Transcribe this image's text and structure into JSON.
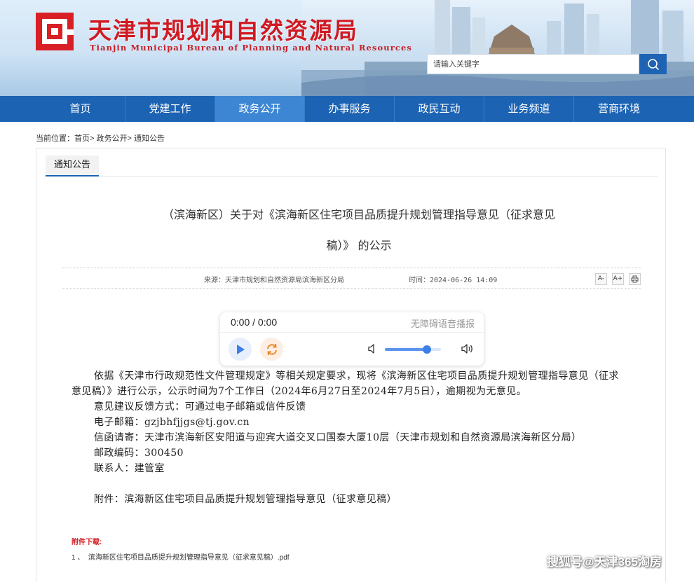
{
  "header": {
    "site_title": "天津市规划和自然资源局",
    "site_subtitle": "Tianjin Municipal Bureau of Planning and Natural Resources",
    "search_placeholder": "请输入关键字",
    "search_icon": "search-icon"
  },
  "nav": {
    "items": [
      "首页",
      "党建工作",
      "政务公开",
      "办事服务",
      "政民互动",
      "业务频道",
      "营商环境"
    ],
    "active_index": 2
  },
  "breadcrumb": {
    "label": "当前位置：",
    "items": [
      "首页",
      "政务公开",
      "通知公告"
    ],
    "separator": ">"
  },
  "tab": {
    "label": "通知公告"
  },
  "article": {
    "title_line1": "（滨海新区）关于对《滨海新区住宅项目品质提升规划管理指导意见（征求意见",
    "title_line2": "稿）》 的公示",
    "source": "来源：天津市规划和自然资源局滨海新区分局",
    "time": "时间：2024-06-26 14:09",
    "tools": {
      "font_smaller": "A-",
      "font_larger": "A+",
      "print_icon": "print-icon"
    }
  },
  "player": {
    "time": "0:00 / 0:00",
    "label": "无障碍语音播报",
    "volume": 0.75
  },
  "body": {
    "p1": "依据《天津市行政规范性文件管理规定》等相关规定要求，现将《滨海新区住宅项目品质提升规划管理指导意见（征求意见稿）》进行公示，公示时间为7个工作日（2024年6月27日至2024年7月5日），逾期视为无意见。",
    "p2": "意见建议反馈方式：可通过电子邮箱或信件反馈",
    "p3": "电子邮箱：gzjbhfjjgs@tj.gov.cn",
    "p4": "信函请寄：天津市滨海新区安阳道与迎宾大道交叉口国泰大厦10层（天津市规划和自然资源局滨海新区分局）",
    "p5": "邮政编码：300450",
    "p6": "联系人：建管室",
    "p7": "附件：滨海新区住宅项目品质提升规划管理指导意见（征求意见稿）"
  },
  "attachments": {
    "heading": "附件下载:",
    "items": [
      {
        "index": "1 、",
        "name": "滨海新区住宅项目品质提升规划管理指导意见（征求意见稿）.pdf"
      }
    ]
  },
  "watermark": "搜狐号@天津365淘房",
  "colors": {
    "brand_red": "#d01a22",
    "nav_blue": "#1c63b3",
    "nav_active": "#3d86d4"
  }
}
